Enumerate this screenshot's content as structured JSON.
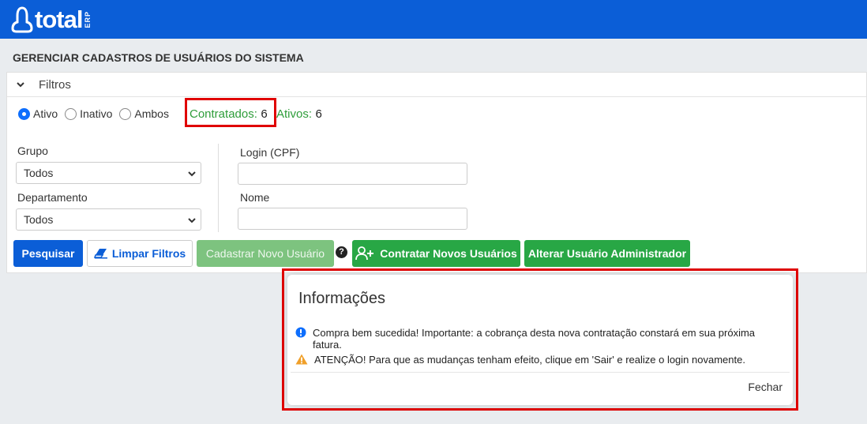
{
  "header": {
    "logo_text": "total",
    "logo_suffix": "ERP",
    "brand_color": "#0b5ed7"
  },
  "page": {
    "title": "GERENCIAR CADASTROS DE USUÁRIOS DO SISTEMA"
  },
  "filters": {
    "section_label": "Filtros",
    "status_options": [
      {
        "label": "Ativo",
        "checked": true
      },
      {
        "label": "Inativo",
        "checked": false
      },
      {
        "label": "Ambos",
        "checked": false
      }
    ],
    "contratados_label": "Contratados:",
    "contratados_value": "6",
    "ativos_label": "Ativos:",
    "ativos_value": "6",
    "grupo_label": "Grupo",
    "grupo_value": "Todos",
    "departamento_label": "Departamento",
    "departamento_value": "Todos",
    "login_label": "Login (CPF)",
    "login_value": "",
    "nome_label": "Nome",
    "nome_value": ""
  },
  "actions": {
    "pesquisar": "Pesquisar",
    "limpar": "Limpar Filtros",
    "cadastrar": "Cadastrar Novo Usuário",
    "help": "?",
    "contratar": "Contratar Novos Usuários",
    "alterar_admin": "Alterar Usuário Administrador"
  },
  "modal": {
    "title": "Informações",
    "info_message": "Compra bem sucedida! Importante: a cobrança desta nova contratação constará em sua próxima fatura.",
    "warning_message": "ATENÇÃO! Para que as mudanças tenham efeito, clique em 'Sair' e realize o login novamente.",
    "close_label": "Fechar",
    "info_icon": "info-circle-icon",
    "warning_icon": "warning-triangle-icon"
  }
}
